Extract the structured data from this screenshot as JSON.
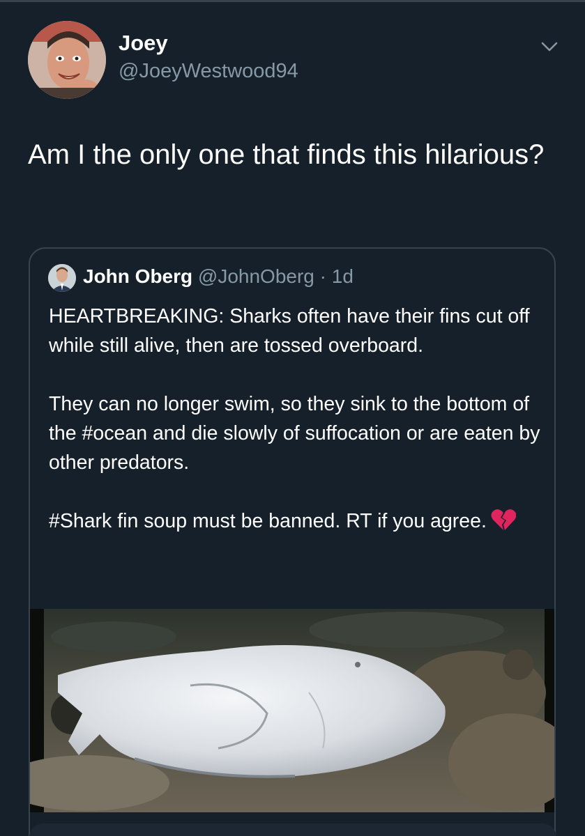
{
  "tweet": {
    "author": {
      "display_name": "Joey",
      "handle": "@JoeyWestwood94",
      "avatar_icon": "profile-photo"
    },
    "menu_icon": "chevron-down-icon",
    "text": "Am I the only one that finds this hilarious?"
  },
  "quoted_tweet": {
    "author": {
      "display_name": "John Oberg",
      "handle": "@JohnOberg",
      "separator": "·",
      "time": "1d",
      "avatar_icon": "profile-photo"
    },
    "paragraphs": [
      "HEARTBREAKING: Sharks often have their fins cut off while still alive, then are tossed overboard.",
      "They can no longer swim, so they sink to the bottom of the #ocean and die slowly of suffocation or are eaten by other predators.",
      "#Shark fin soup must be banned. RT if you agree."
    ],
    "emoji_icon": "broken-heart-icon",
    "media_icon": "shark-video-thumbnail"
  },
  "colors": {
    "background": "#15202b",
    "text_primary": "#ffffff",
    "text_secondary": "#8899a6",
    "border": "#38444d",
    "broken_heart": "#e0245e"
  }
}
